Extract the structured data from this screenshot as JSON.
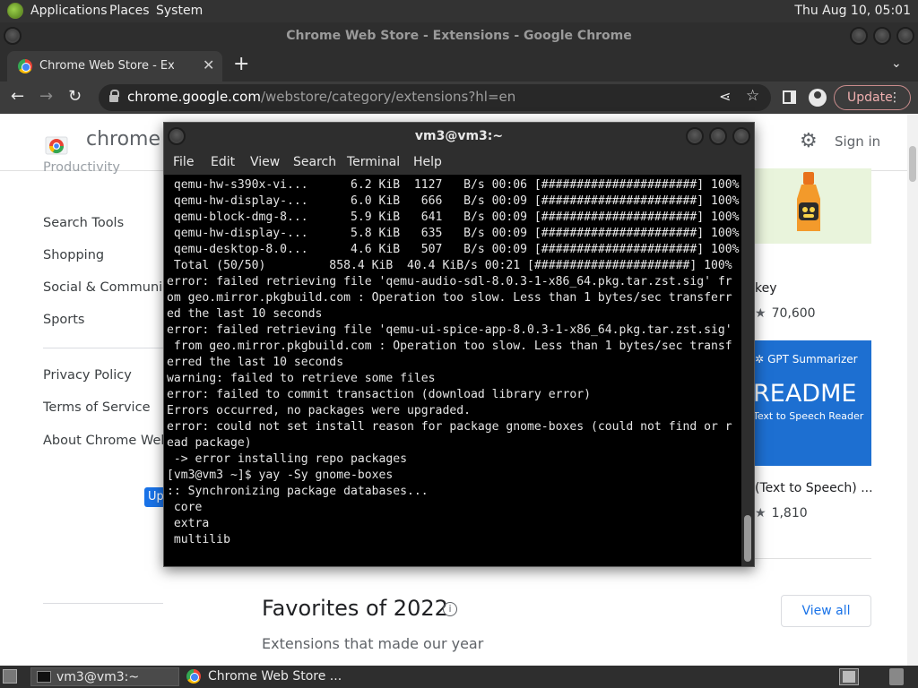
{
  "top_panel": {
    "menus": [
      "Applications",
      "Places",
      "System"
    ],
    "clock": "Thu Aug 10, 05:01"
  },
  "chrome": {
    "window_title": "Chrome Web Store - Extensions - Google Chrome",
    "tab_label": "Chrome Web Store - Extensions",
    "url_host": "chrome.google.com",
    "url_path": "/webstore/category/extensions?hl=en",
    "update_label": "Update"
  },
  "store": {
    "title": "chrome web store",
    "sign_in": "Sign in",
    "nav": {
      "cut_top": "Productivity",
      "items": [
        "Search Tools",
        "Shopping",
        "Social & Communication",
        "Sports"
      ],
      "footer": [
        "Privacy Policy",
        "Terms of Service",
        "About Chrome Web Store"
      ],
      "update_chip": "Updated"
    },
    "cards": [
      {
        "name": "key",
        "rating_count": "70,600"
      },
      {
        "banner_top": "GPT Summarizer",
        "banner_main": "README",
        "banner_sub": "Text to Speech Reader",
        "name": "(Text to Speech) ...",
        "rating_count": "1,810"
      }
    ],
    "favorites_title": "Favorites of 2022",
    "favorites_subtitle": "Extensions that made our year",
    "view_all": "View all"
  },
  "terminal": {
    "title": "vm3@vm3:~",
    "menus": [
      "File",
      "Edit",
      "View",
      "Search",
      "Terminal",
      "Help"
    ],
    "lines": [
      " qemu-hw-s390x-vi...      6.2 KiB  1127   B/s 00:06 [######################] 100%",
      " qemu-hw-display-...      6.0 KiB   666   B/s 00:09 [######################] 100%",
      " qemu-block-dmg-8...      5.9 KiB   641   B/s 00:09 [######################] 100%",
      " qemu-hw-display-...      5.8 KiB   635   B/s 00:09 [######################] 100%",
      " qemu-desktop-8.0...      4.6 KiB   507   B/s 00:09 [######################] 100%",
      " Total (50/50)         858.4 KiB  40.4 KiB/s 00:21 [######################] 100%",
      "error: failed retrieving file 'qemu-audio-sdl-8.0.3-1-x86_64.pkg.tar.zst.sig' fr",
      "om geo.mirror.pkgbuild.com : Operation too slow. Less than 1 bytes/sec transferr",
      "ed the last 10 seconds",
      "error: failed retrieving file 'qemu-ui-spice-app-8.0.3-1-x86_64.pkg.tar.zst.sig'",
      " from geo.mirror.pkgbuild.com : Operation too slow. Less than 1 bytes/sec transf",
      "erred the last 10 seconds",
      "warning: failed to retrieve some files",
      "error: failed to commit transaction (download library error)",
      "Errors occurred, no packages were upgraded.",
      "error: could not set install reason for package gnome-boxes (could not find or r",
      "ead package)",
      " -> error installing repo packages",
      "[vm3@vm3 ~]$ yay -Sy gnome-boxes",
      ":: Synchronizing package databases...",
      " core",
      " extra",
      " multilib"
    ]
  },
  "taskbar": {
    "items": [
      "vm3@vm3:~",
      "Chrome Web Store ..."
    ]
  }
}
